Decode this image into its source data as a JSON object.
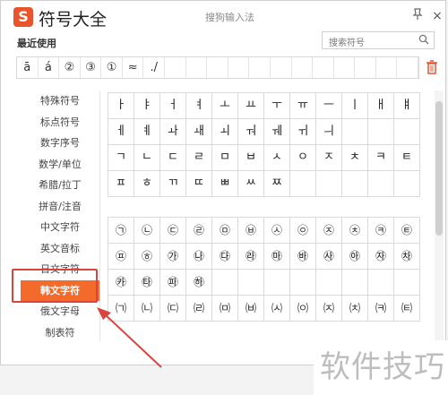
{
  "window": {
    "logo": "S",
    "title": "符号大全",
    "subtitle": "搜狗输入法",
    "pin_icon": "pin-icon",
    "close_glyph": "×"
  },
  "recent": {
    "label": "最近使用",
    "symbols": [
      "ā",
      "á",
      "②",
      "③",
      "①",
      "≈",
      "./",
      "",
      "",
      "",
      "",
      "",
      "",
      "",
      "",
      "",
      "",
      "",
      ""
    ],
    "trash_icon": "trash-icon"
  },
  "search": {
    "placeholder": "搜索符号",
    "icon": "search-icon"
  },
  "sidebar": {
    "items": [
      {
        "label": "特殊符号"
      },
      {
        "label": "标点符号"
      },
      {
        "label": "数字序号"
      },
      {
        "label": "数学/单位"
      },
      {
        "label": "希腊/拉丁"
      },
      {
        "label": "拼音/注音"
      },
      {
        "label": "中文字符"
      },
      {
        "label": "英文音标"
      },
      {
        "label": "日文字符"
      },
      {
        "label": "韩文字符",
        "active": true
      },
      {
        "label": "俄文字母"
      },
      {
        "label": "制表符"
      }
    ]
  },
  "grid1": [
    [
      "ㅏ",
      "ㅑ",
      "ㅓ",
      "ㅕ",
      "ㅗ",
      "ㅛ",
      "ㅜ",
      "ㅠ",
      "ㅡ",
      "ㅣ",
      "ㅐ",
      "ㅒ"
    ],
    [
      "ㅔ",
      "ㅖ",
      "ㅘ",
      "ㅙ",
      "ㅚ",
      "ㅝ",
      "ㅞ",
      "ㅟ",
      "ㅢ",
      "",
      "",
      ""
    ],
    [
      "ㄱ",
      "ㄴ",
      "ㄷ",
      "ㄹ",
      "ㅁ",
      "ㅂ",
      "ㅅ",
      "ㅇ",
      "ㅈ",
      "ㅊ",
      "ㅋ",
      "ㅌ"
    ],
    [
      "ㅍ",
      "ㅎ",
      "ㄲ",
      "ㄸ",
      "ㅃ",
      "ㅆ",
      "ㅉ",
      "",
      "",
      "",
      "",
      ""
    ]
  ],
  "grid2": [
    [
      "㉠",
      "㉡",
      "㉢",
      "㉣",
      "㉤",
      "㉥",
      "㉦",
      "㉧",
      "㉨",
      "㉩",
      "㉪",
      "㉫"
    ],
    [
      "㉬",
      "㉭",
      "㉮",
      "㉯",
      "㉰",
      "㉱",
      "㉲",
      "㉳",
      "㉴",
      "㉵",
      "㉶",
      "㉷"
    ],
    [
      "㉸",
      "㉹",
      "㉺",
      "㉻",
      "",
      "",
      "",
      "",
      "",
      "",
      "",
      ""
    ],
    [
      "㈀",
      "㈁",
      "㈂",
      "㈃",
      "㈄",
      "㈅",
      "㈆",
      "㈇",
      "㈈",
      "㈉",
      "㈊",
      "㈋"
    ]
  ],
  "watermark": "软件技巧"
}
